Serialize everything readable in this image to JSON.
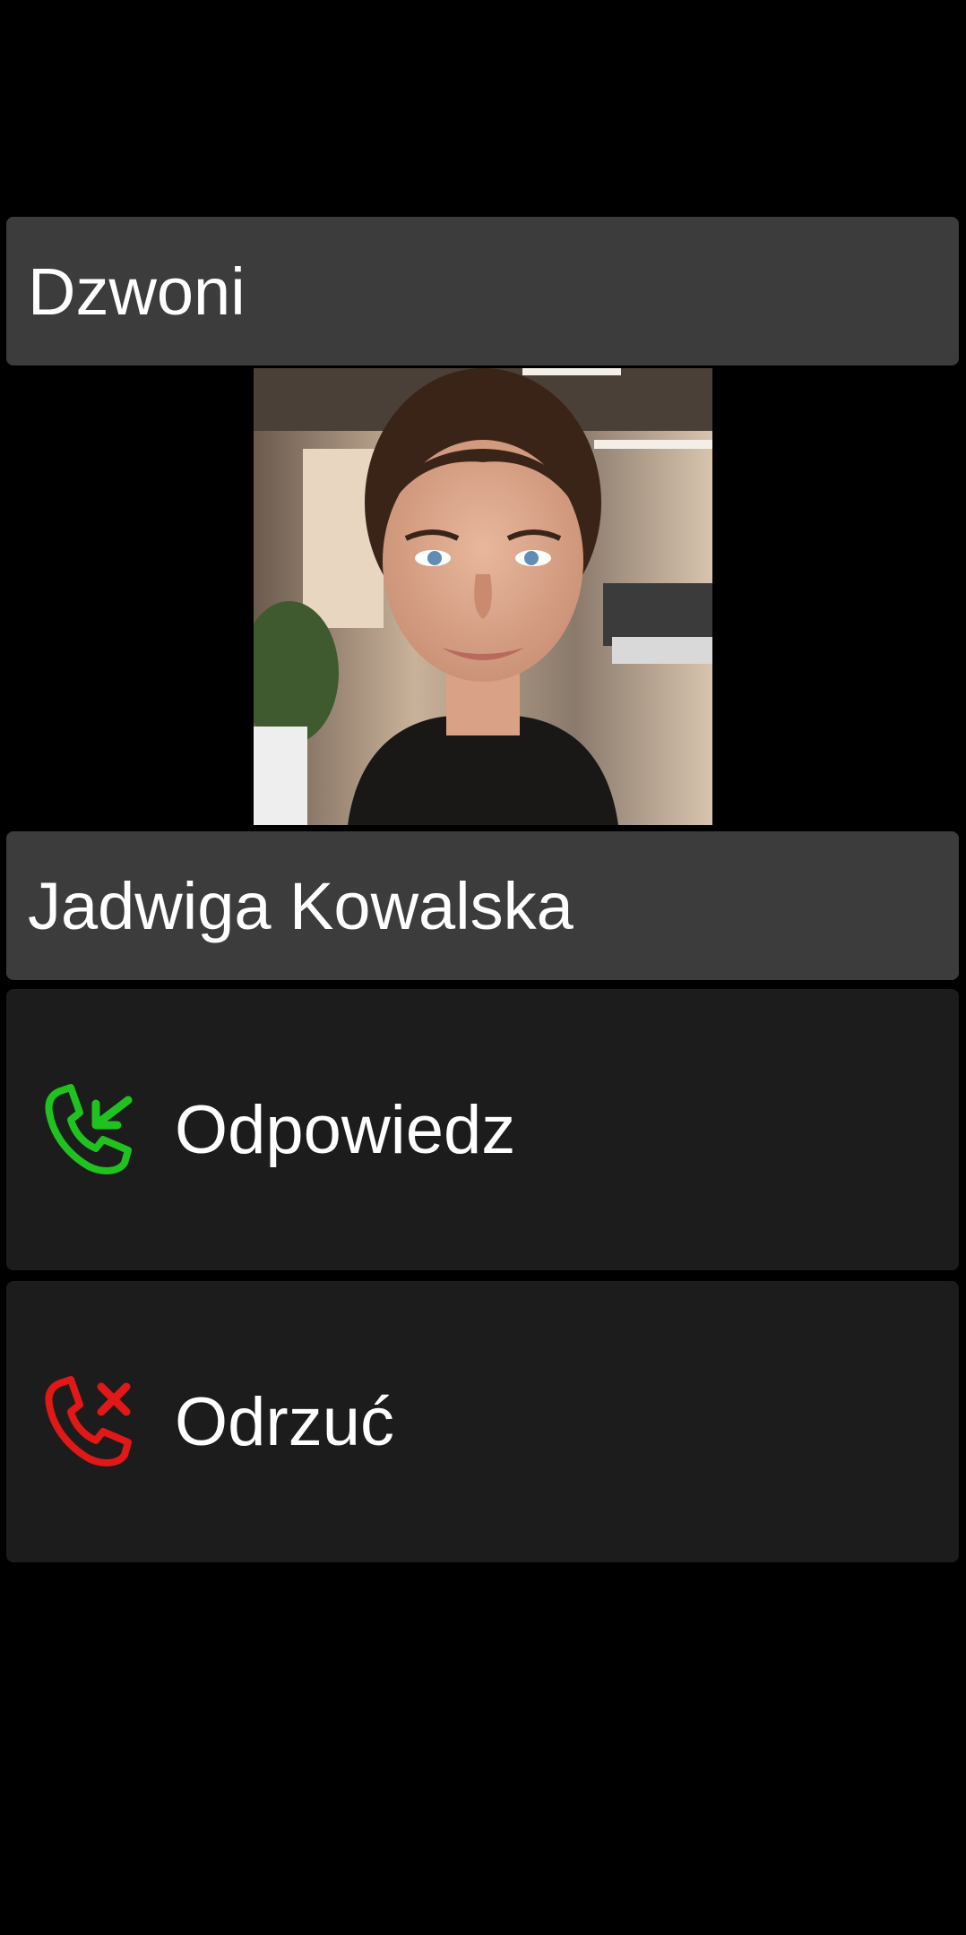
{
  "call": {
    "status_label": "Dzwoni",
    "caller_name": "Jadwiga Kowalska"
  },
  "actions": {
    "answer_label": "Odpowiedz",
    "answer_icon": "phone-incoming-icon",
    "answer_color": "#1fc21f",
    "reject_label": "Odrzuć",
    "reject_icon": "phone-decline-icon",
    "reject_color": "#e01818"
  },
  "colors": {
    "background": "#000000",
    "panel": "#3c3c3c",
    "button": "#1c1c1c",
    "text": "#ffffff"
  }
}
